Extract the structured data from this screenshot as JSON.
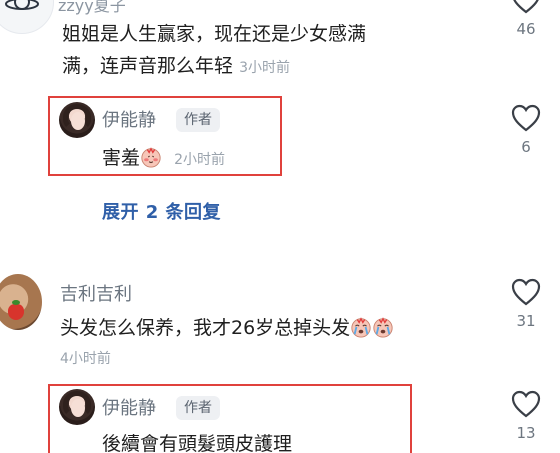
{
  "comments": [
    {
      "user": "zzyy夏子",
      "text_line1": "姐姐是人生赢家，现在还是少女感满",
      "text_line2": "满，连声音那么年轻",
      "time": "3小时前",
      "likes": "46"
    },
    {
      "user": "吉利吉利",
      "text": "头发怎么保养，我才26岁总掉头发",
      "time": "4小时前",
      "likes": "31"
    }
  ],
  "replies": [
    {
      "user": "伊能静",
      "tag": "作者",
      "text": "害羞",
      "time": "2小时前",
      "likes": "6"
    },
    {
      "user": "伊能静",
      "tag": "作者",
      "text": "後續會有頭髮頭皮護理",
      "likes": "13"
    }
  ],
  "expand_label": "展开 2 条回复",
  "colors": {
    "highlight": "#e0413c",
    "link": "#2f5fa8"
  },
  "icons": {
    "like": "heart-outline-icon",
    "shy": "shy-face-emoji",
    "cry": "crying-face-emoji"
  }
}
